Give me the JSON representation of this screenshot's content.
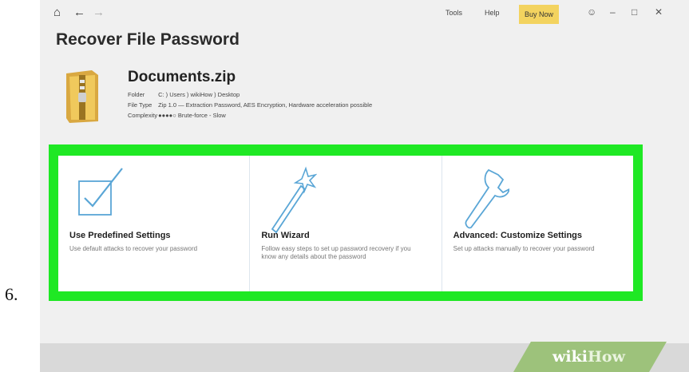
{
  "step_number": "6.",
  "titlebar": {
    "tools": "Tools",
    "help": "Help",
    "buy_now": "Buy Now",
    "icons": [
      "home-icon",
      "back-arrow-icon",
      "forward-arrow-icon",
      "user-icon",
      "minimize-icon",
      "maximize-icon",
      "close-icon"
    ]
  },
  "page_title": "Recover File Password",
  "file": {
    "name": "Documents.zip",
    "folder_label": "Folder",
    "folder_value": "C: ) Users ) wikiHow ) Desktop",
    "type_label": "File Type",
    "type_value": "Zip 1.0 — Extraction Password, AES Encryption, Hardware acceleration possible",
    "complexity_label": "Complexity",
    "complexity_value": "●●●●○ Brute-force - Slow"
  },
  "options": [
    {
      "title": "Use Predefined Settings",
      "description": "Use default attacks to recover your password"
    },
    {
      "title": "Run Wizard",
      "description": "Follow easy steps to set up password recovery if you know any details about the password"
    },
    {
      "title": "Advanced: Customize Settings",
      "description": "Set up attacks manually to recover your password"
    }
  ],
  "colors": {
    "highlight": "#1fe824",
    "icon_blue": "#5aa6d6",
    "buy_button": "#f3d35f"
  },
  "watermark": {
    "wiki": "wiki",
    "how": "How"
  }
}
